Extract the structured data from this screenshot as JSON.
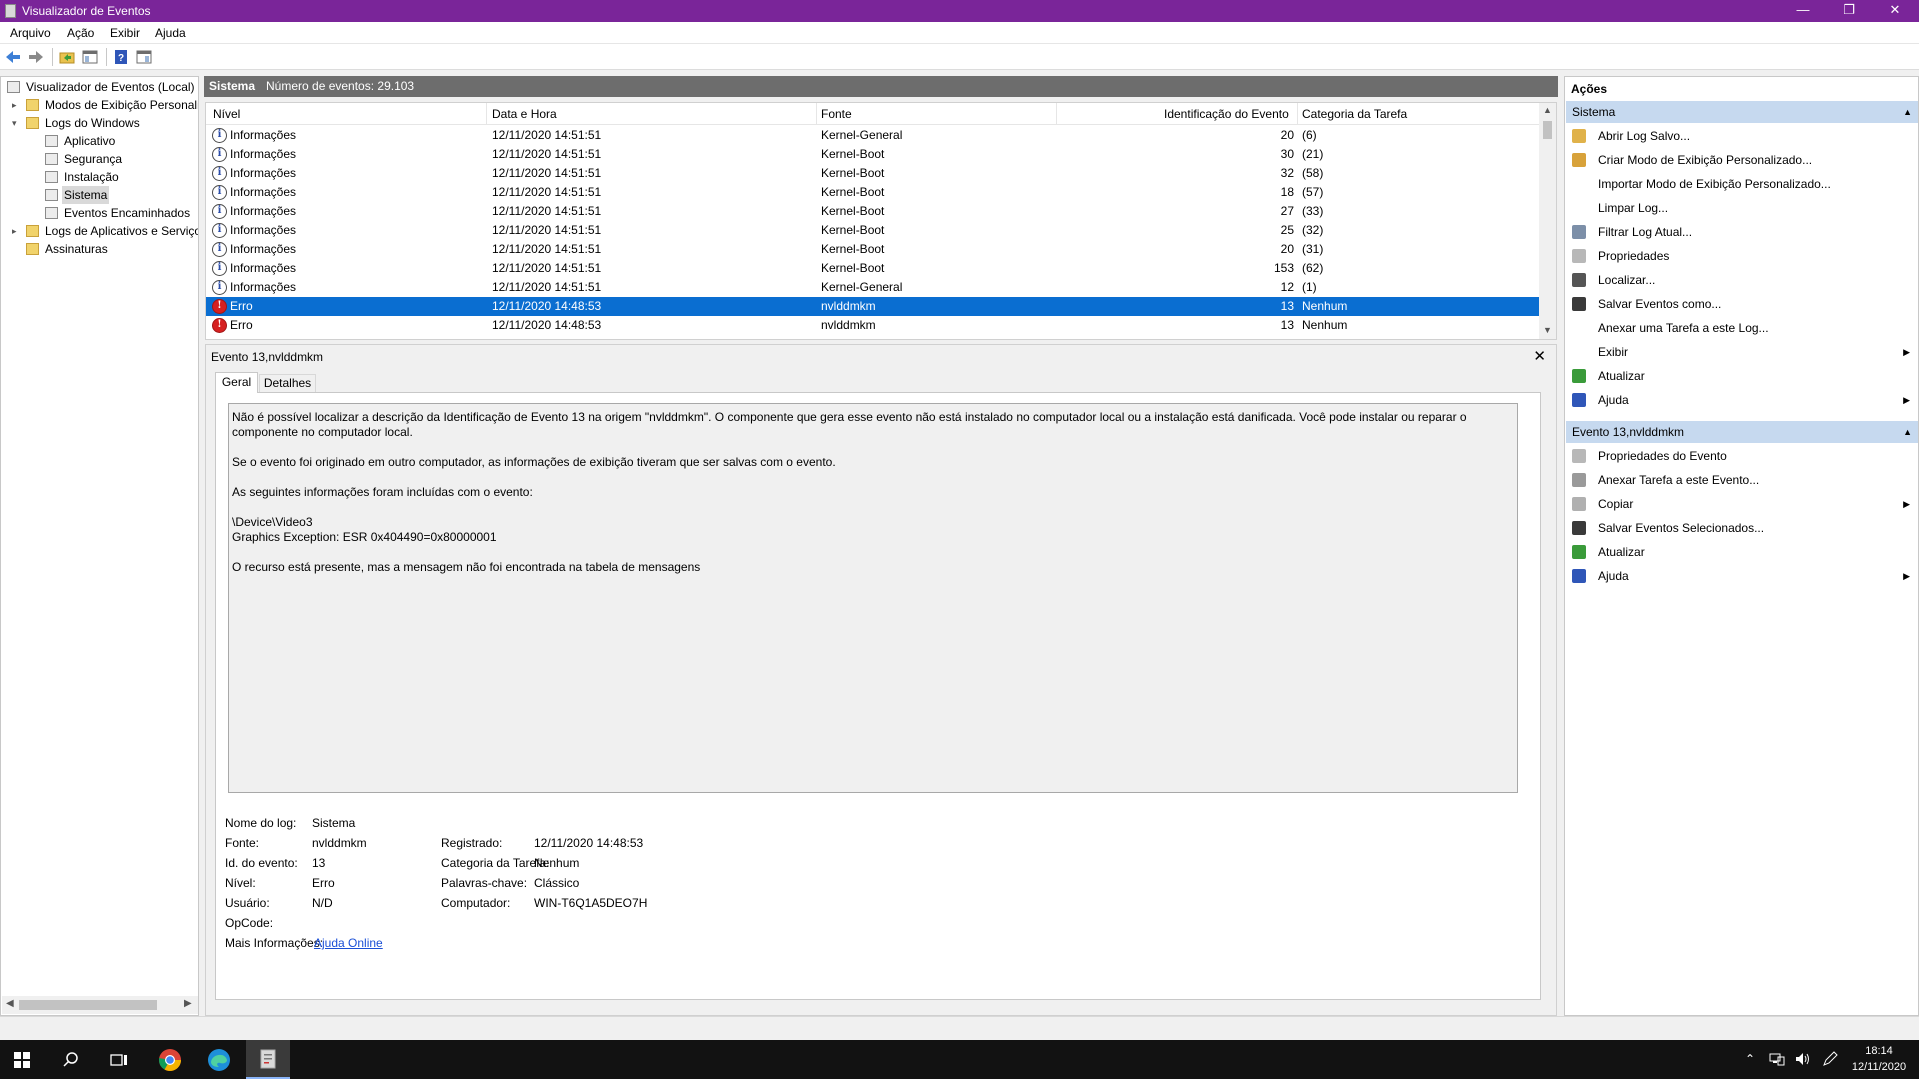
{
  "window": {
    "title": "Visualizador de Eventos",
    "minimize": "—",
    "restore": "❐",
    "close": "✕"
  },
  "menu": [
    "Arquivo",
    "Ação",
    "Exibir",
    "Ajuda"
  ],
  "tree": {
    "root": "Visualizador de Eventos (Local)",
    "custom_views": "Modos de Exibição Personali",
    "windows_logs": "Logs do Windows",
    "logs": [
      "Aplicativo",
      "Segurança",
      "Instalação",
      "Sistema",
      "Eventos Encaminhados"
    ],
    "app_logs": "Logs de Aplicativos e Serviço",
    "subscriptions": "Assinaturas",
    "selected": "Sistema"
  },
  "center": {
    "header_title": "Sistema",
    "header_count": "Número de eventos: 29.103",
    "columns": [
      "Nível",
      "Data e Hora",
      "Fonte",
      "Identificação do Evento",
      "Categoria da Tarefa"
    ],
    "rows": [
      {
        "level": "Informações",
        "type": "info",
        "datetime": "12/11/2020 14:51:51",
        "source": "Kernel-General",
        "event_id": "20",
        "category": "(6)"
      },
      {
        "level": "Informações",
        "type": "info",
        "datetime": "12/11/2020 14:51:51",
        "source": "Kernel-Boot",
        "event_id": "30",
        "category": "(21)"
      },
      {
        "level": "Informações",
        "type": "info",
        "datetime": "12/11/2020 14:51:51",
        "source": "Kernel-Boot",
        "event_id": "32",
        "category": "(58)"
      },
      {
        "level": "Informações",
        "type": "info",
        "datetime": "12/11/2020 14:51:51",
        "source": "Kernel-Boot",
        "event_id": "18",
        "category": "(57)"
      },
      {
        "level": "Informações",
        "type": "info",
        "datetime": "12/11/2020 14:51:51",
        "source": "Kernel-Boot",
        "event_id": "27",
        "category": "(33)"
      },
      {
        "level": "Informações",
        "type": "info",
        "datetime": "12/11/2020 14:51:51",
        "source": "Kernel-Boot",
        "event_id": "25",
        "category": "(32)"
      },
      {
        "level": "Informações",
        "type": "info",
        "datetime": "12/11/2020 14:51:51",
        "source": "Kernel-Boot",
        "event_id": "20",
        "category": "(31)"
      },
      {
        "level": "Informações",
        "type": "info",
        "datetime": "12/11/2020 14:51:51",
        "source": "Kernel-Boot",
        "event_id": "153",
        "category": "(62)"
      },
      {
        "level": "Informações",
        "type": "info",
        "datetime": "12/11/2020 14:51:51",
        "source": "Kernel-General",
        "event_id": "12",
        "category": "(1)"
      },
      {
        "level": "Erro",
        "type": "error",
        "datetime": "12/11/2020 14:48:53",
        "source": "nvlddmkm",
        "event_id": "13",
        "category": "Nenhum",
        "selected": true
      },
      {
        "level": "Erro",
        "type": "error",
        "datetime": "12/11/2020 14:48:53",
        "source": "nvlddmkm",
        "event_id": "13",
        "category": "Nenhum"
      }
    ]
  },
  "detail": {
    "title": "Evento 13,nvlddmkm",
    "close": "✕",
    "tabs": [
      "Geral",
      "Detalhes"
    ],
    "description": {
      "p1": "Não é possível localizar a descrição da Identificação de Evento 13 na origem \"nvlddmkm\". O componente que gera esse evento não está instalado no computador local ou a instalação está danificada. Você pode instalar ou reparar o componente no computador local.",
      "p2": "Se o evento foi originado em outro computador, as informações de exibição tiveram que ser salvas com o evento.",
      "p3": "As seguintes informações foram incluídas com o evento:",
      "p4a": "\\Device\\Video3",
      "p4b": "Graphics Exception: ESR 0x404490=0x80000001",
      "p5": "O recurso está presente, mas a mensagem não foi encontrada na tabela de mensagens"
    },
    "props": {
      "log_name_label": "Nome do log:",
      "log_name": "Sistema",
      "source_label": "Fonte:",
      "source": "nvlddmkm",
      "logged_label": "Registrado:",
      "logged": "12/11/2020 14:48:53",
      "event_id_label": "Id. do evento:",
      "event_id": "13",
      "task_cat_label": "Categoria da Tarefa:",
      "task_cat": "Nenhum",
      "level_label": "Nível:",
      "level": "Erro",
      "keywords_label": "Palavras-chave:",
      "keywords": "Clássico",
      "user_label": "Usuário:",
      "user": "N/D",
      "computer_label": "Computador:",
      "computer": "WIN-T6Q1A5DEO7H",
      "opcode_label": "OpCode:",
      "opcode": "",
      "more_info_label": "Mais Informações:",
      "more_info_link": "Ajuda Online"
    }
  },
  "actions": {
    "title": "Ações",
    "section1": "Sistema",
    "section1_items": [
      {
        "label": "Abrir Log Salvo...",
        "icon": "open-folder-icon",
        "color": "#e0b24a"
      },
      {
        "label": "Criar Modo de Exibição Personalizado...",
        "icon": "filter-create-icon",
        "color": "#d8a23a"
      },
      {
        "label": "Importar Modo de Exibição Personalizado...",
        "icon": "",
        "color": ""
      },
      {
        "label": "Limpar Log...",
        "icon": "",
        "color": ""
      },
      {
        "label": "Filtrar Log Atual...",
        "icon": "filter-icon",
        "color": "#7c8fa8"
      },
      {
        "label": "Propriedades",
        "icon": "properties-icon",
        "color": "#b8b8b8"
      },
      {
        "label": "Localizar...",
        "icon": "binoculars-icon",
        "color": "#555555"
      },
      {
        "label": "Salvar Eventos como...",
        "icon": "save-icon",
        "color": "#3a3a3a"
      },
      {
        "label": "Anexar uma Tarefa a este Log...",
        "icon": "",
        "color": ""
      },
      {
        "label": "Exibir",
        "icon": "",
        "color": "",
        "submenu": true
      },
      {
        "label": "Atualizar",
        "icon": "refresh-icon",
        "color": "#3a9b3a"
      },
      {
        "label": "Ajuda",
        "icon": "help-icon",
        "color": "#2f56b8",
        "submenu": true
      }
    ],
    "section2": "Evento 13,nvlddmkm",
    "section2_items": [
      {
        "label": "Propriedades do Evento",
        "icon": "event-properties-icon",
        "color": "#b8b8b8"
      },
      {
        "label": "Anexar Tarefa a este Evento...",
        "icon": "attach-task-icon",
        "color": "#9a9a9a"
      },
      {
        "label": "Copiar",
        "icon": "copy-icon",
        "color": "#b0b0b0",
        "submenu": true
      },
      {
        "label": "Salvar Eventos Selecionados...",
        "icon": "save-icon",
        "color": "#3a3a3a"
      },
      {
        "label": "Atualizar",
        "icon": "refresh-icon",
        "color": "#3a9b3a"
      },
      {
        "label": "Ajuda",
        "icon": "help-icon",
        "color": "#2f56b8",
        "submenu": true
      }
    ]
  },
  "taskbar": {
    "time": "18:14",
    "date": "12/11/2020"
  },
  "colors": {
    "titlebar": "#7a2599",
    "selection": "#0a6ed1",
    "section_header": "#c6d9ef",
    "error": "#d62020"
  }
}
